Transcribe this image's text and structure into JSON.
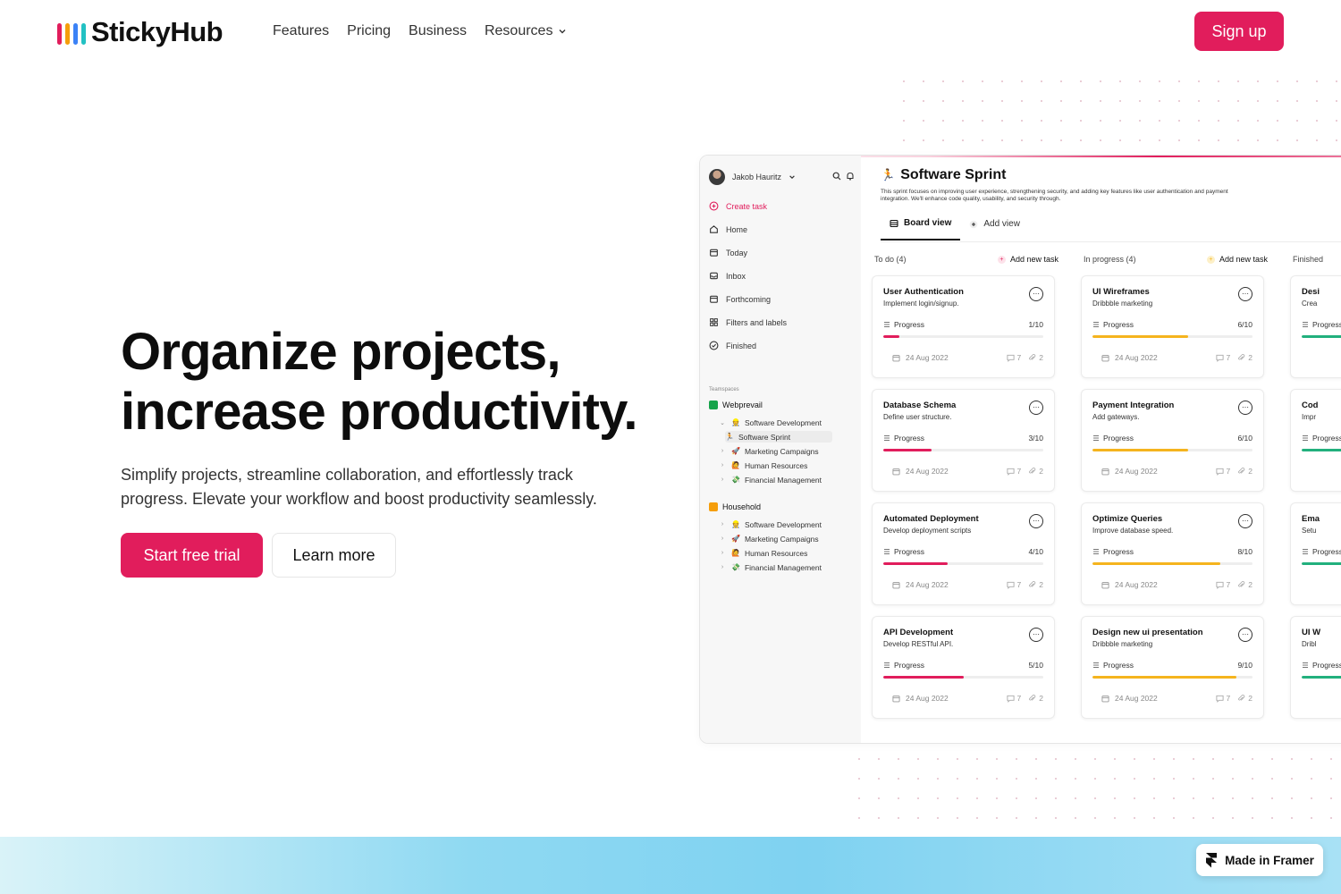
{
  "brand": {
    "name": "StickyHub",
    "colors": [
      "#e11d5c",
      "#f59e0b",
      "#3b82f6",
      "#22c1c3"
    ]
  },
  "nav": {
    "links": [
      "Features",
      "Pricing",
      "Business",
      "Resources"
    ],
    "signup": "Sign up"
  },
  "hero": {
    "title_line1": "Organize projects,",
    "title_line2": "increase productivity.",
    "subtitle": "Simplify projects, streamline collaboration, and effortlessly track progress. Elevate your workflow and boost productivity seamlessly.",
    "primary_cta": "Start free trial",
    "secondary_cta": "Learn more"
  },
  "app": {
    "user": "Jakob Hauritz",
    "sidebar": [
      {
        "label": "Create task",
        "icon": "plus-circle-icon"
      },
      {
        "label": "Home",
        "icon": "home-icon"
      },
      {
        "label": "Today",
        "icon": "calendar-icon"
      },
      {
        "label": "Inbox",
        "icon": "inbox-icon"
      },
      {
        "label": "Forthcoming",
        "icon": "calendar-icon"
      },
      {
        "label": "Filters and labels",
        "icon": "grid-icon"
      },
      {
        "label": "Finished",
        "icon": "check-circle-icon"
      }
    ],
    "teamspaces_label": "Teamspaces",
    "teams": [
      {
        "name": "Webprevail",
        "color": "#16a34a",
        "items": [
          {
            "label": "Software Development",
            "emoji": "👷"
          },
          {
            "label": "Software Sprint",
            "emoji": "🏃"
          },
          {
            "label": "Marketing Campaigns",
            "emoji": "🚀"
          },
          {
            "label": "Human Resources",
            "emoji": "🙋"
          },
          {
            "label": "Financial Management",
            "emoji": "💸"
          }
        ]
      },
      {
        "name": "Household",
        "color": "#f59e0b",
        "items": [
          {
            "label": "Software Development",
            "emoji": "👷"
          },
          {
            "label": "Marketing Campaigns",
            "emoji": "🚀"
          },
          {
            "label": "Human Resources",
            "emoji": "🙋"
          },
          {
            "label": "Financial Management",
            "emoji": "💸"
          }
        ]
      }
    ],
    "project": {
      "emoji": "🏃",
      "title": "Software Sprint",
      "description": "This sprint focuses on improving user experience, strengthening security, and adding key features like user authentication and payment integration. We'll enhance code quality, usability, and security through."
    },
    "views": [
      "Board view",
      "Add view"
    ],
    "add_task_label": "Add new task",
    "progress_label": "Progress",
    "columns": [
      {
        "title": "To do (4)",
        "color": "#e11d5c",
        "cards": [
          {
            "title": "User Authentication",
            "subtitle": "Implement login/signup.",
            "progress": "1/10",
            "fraction": 0.1,
            "date": "24 Aug 2022",
            "comments": "7",
            "attachments": "2"
          },
          {
            "title": "Database Schema",
            "subtitle": "Define user structure.",
            "progress": "3/10",
            "fraction": 0.3,
            "date": "24 Aug 2022",
            "comments": "7",
            "attachments": "2"
          },
          {
            "title": "Automated Deployment",
            "subtitle": "Develop deployment scripts",
            "progress": "4/10",
            "fraction": 0.4,
            "date": "24 Aug 2022",
            "comments": "7",
            "attachments": "2"
          },
          {
            "title": "API Development",
            "subtitle": "Develop RESTful API.",
            "progress": "5/10",
            "fraction": 0.5,
            "date": "24 Aug 2022",
            "comments": "7",
            "attachments": "2"
          }
        ]
      },
      {
        "title": "In progress (4)",
        "color": "#f5b41e",
        "cards": [
          {
            "title": "UI Wireframes",
            "subtitle": "Dribbble marketing",
            "progress": "6/10",
            "fraction": 0.6,
            "date": "24 Aug 2022",
            "comments": "7",
            "attachments": "2"
          },
          {
            "title": "Payment Integration",
            "subtitle": "Add gateways.",
            "progress": "6/10",
            "fraction": 0.6,
            "date": "24 Aug 2022",
            "comments": "7",
            "attachments": "2"
          },
          {
            "title": "Optimize Queries",
            "subtitle": "Improve database speed.",
            "progress": "8/10",
            "fraction": 0.8,
            "date": "24 Aug 2022",
            "comments": "7",
            "attachments": "2"
          },
          {
            "title": "Design new ui presentation",
            "subtitle": "Dribbble marketing",
            "progress": "9/10",
            "fraction": 0.9,
            "date": "24 Aug 2022",
            "comments": "7",
            "attachments": "2"
          }
        ]
      },
      {
        "title": "Finished",
        "color": "#22b07d",
        "cards": [
          {
            "title": "Desi",
            "subtitle": "Crea",
            "progress": "",
            "fraction": 1.0,
            "date": "",
            "comments": "",
            "attachments": ""
          },
          {
            "title": "Cod",
            "subtitle": "Impr",
            "progress": "",
            "fraction": 1.0,
            "date": "",
            "comments": "",
            "attachments": ""
          },
          {
            "title": "Ema",
            "subtitle": "Setu",
            "progress": "",
            "fraction": 1.0,
            "date": "",
            "comments": "",
            "attachments": ""
          },
          {
            "title": "UI W",
            "subtitle": "Dribl",
            "progress": "",
            "fraction": 1.0,
            "date": "",
            "comments": "",
            "attachments": ""
          }
        ]
      }
    ]
  },
  "badge": {
    "label": "Made in Framer"
  }
}
